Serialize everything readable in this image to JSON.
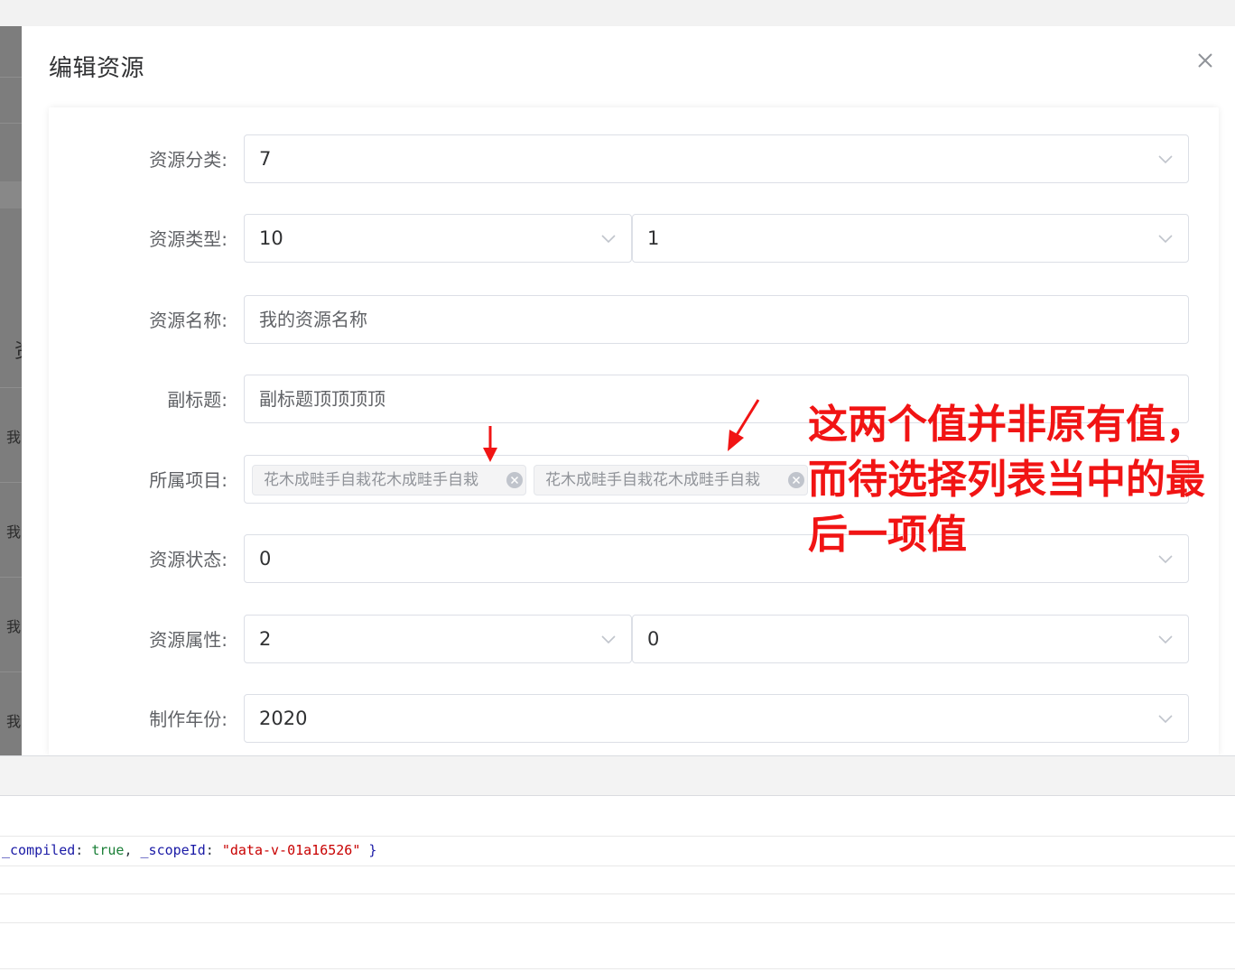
{
  "dialog": {
    "title": "编辑资源",
    "close_icon": "close-icon"
  },
  "form": {
    "category": {
      "label": "资源分类:",
      "value": "7"
    },
    "type": {
      "label": "资源类型:",
      "value_a": "10",
      "value_b": "1"
    },
    "name": {
      "label": "资源名称:",
      "value": "我的资源名称"
    },
    "subtitle": {
      "label": "副标题:",
      "value": "副标题顶顶顶顶"
    },
    "project": {
      "label": "所属项目:",
      "tags": [
        "花木成畦手自栽花木成畦手自栽",
        "花木成畦手自栽花木成畦手自栽"
      ]
    },
    "status": {
      "label": "资源状态:",
      "value": "0"
    },
    "attribute": {
      "label": "资源属性:",
      "value_a": "2",
      "value_b": "0"
    },
    "year": {
      "label": "制作年份:",
      "value": "2020"
    }
  },
  "background": {
    "side_chars": [
      "资",
      "我",
      "我",
      "我",
      "我"
    ]
  },
  "console": {
    "log": {
      "key1": "_compiled",
      "val1": "true",
      "key2": "_scopeId",
      "val2": "\"data-v-01a16526\""
    }
  },
  "annotation": {
    "text": "这两个值并非原有值，而待选择列表当中的最后一项值",
    "color": "#f11414"
  },
  "colors": {
    "border": "#dcdfe6",
    "label": "#606266",
    "tag_bg": "#f4f4f5"
  }
}
